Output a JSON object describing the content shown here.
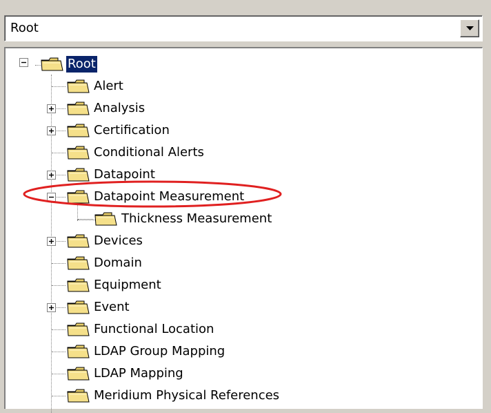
{
  "dropdown": {
    "value": "Root"
  },
  "tree": {
    "root": {
      "label": "Root",
      "expanded": true,
      "selected": true
    },
    "items": [
      {
        "label": "Alert",
        "expander": "none"
      },
      {
        "label": "Analysis",
        "expander": "plus"
      },
      {
        "label": "Certification",
        "expander": "plus"
      },
      {
        "label": "Conditional Alerts",
        "expander": "none"
      },
      {
        "label": "Datapoint",
        "expander": "plus"
      },
      {
        "label": "Datapoint Measurement",
        "expander": "minus",
        "children": [
          {
            "label": "Thickness Measurement"
          }
        ]
      },
      {
        "label": "Devices",
        "expander": "plus"
      },
      {
        "label": "Domain",
        "expander": "none"
      },
      {
        "label": "Equipment",
        "expander": "none"
      },
      {
        "label": "Event",
        "expander": "plus"
      },
      {
        "label": "Functional Location",
        "expander": "none"
      },
      {
        "label": "LDAP Group Mapping",
        "expander": "none"
      },
      {
        "label": "LDAP Mapping",
        "expander": "none"
      },
      {
        "label": "Meridium Physical References",
        "expander": "none"
      }
    ]
  },
  "colors": {
    "selection": "#0a246a",
    "folder": "#f5e08a",
    "annotation": "#e02020"
  },
  "annotation": {
    "shape": "ellipse",
    "target": "Datapoint Measurement"
  }
}
